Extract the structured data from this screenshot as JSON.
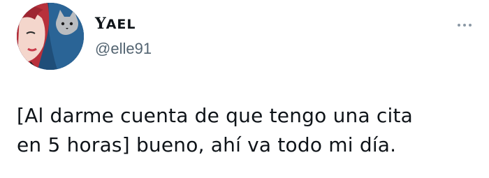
{
  "tweet": {
    "author": {
      "display_name_first": "Y",
      "display_name_rest": "AEL",
      "handle": "@elle91",
      "avatar_icon": "profile-avatar-illustration"
    },
    "more_icon": "more-options-icon",
    "text_lines": [
      "[Al darme cuenta de que tengo una cita",
      "en 5 horas] bueno, ahí va todo mi día."
    ]
  },
  "colors": {
    "text": "#0f1419",
    "secondary_text": "#536471",
    "avatar_background": "#1e4f7a",
    "hair": "#c9343f"
  }
}
